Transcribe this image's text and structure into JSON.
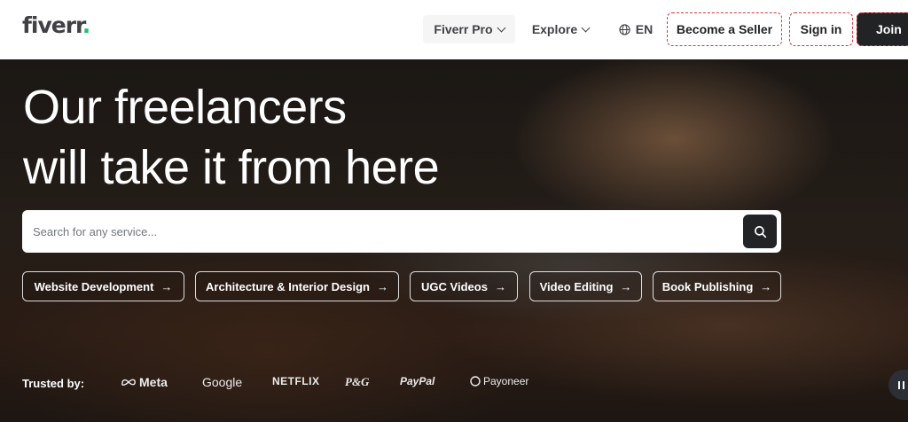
{
  "header": {
    "logo_text": "fiverr",
    "logo_dot": ".",
    "nav": {
      "pro_label": "Fiverr Pro",
      "explore_label": "Explore",
      "language_label": "EN"
    },
    "become_seller_label": "Become a Seller",
    "sign_in_label": "Sign in",
    "join_label": "Join"
  },
  "hero": {
    "headline_line1": "Our freelancers",
    "headline_line2": "will take it from here",
    "search": {
      "placeholder": "Search for any service...",
      "value": ""
    },
    "chips": [
      {
        "label": "Website Development",
        "arrow": "→"
      },
      {
        "label": "Architecture & Interior Design",
        "arrow": "→"
      },
      {
        "label": "UGC Videos",
        "arrow": "→"
      },
      {
        "label": "Video Editing",
        "arrow": "→"
      },
      {
        "label": "Book Publishing",
        "arrow": "→"
      }
    ],
    "trusted": {
      "label": "Trusted by:",
      "brands": [
        "Meta",
        "Google",
        "NETFLIX",
        "P&G",
        "PayPal",
        "Payoneer"
      ]
    }
  },
  "colors": {
    "brand_green": "#1dbf73",
    "dark": "#222325",
    "text": "#404145",
    "focus_outline": "#e0363e"
  },
  "icons": {
    "search": "search-icon",
    "globe": "globe-icon",
    "chevron": "chevron-down-icon",
    "arrow": "arrow-right-icon",
    "pause": "pause-icon"
  }
}
